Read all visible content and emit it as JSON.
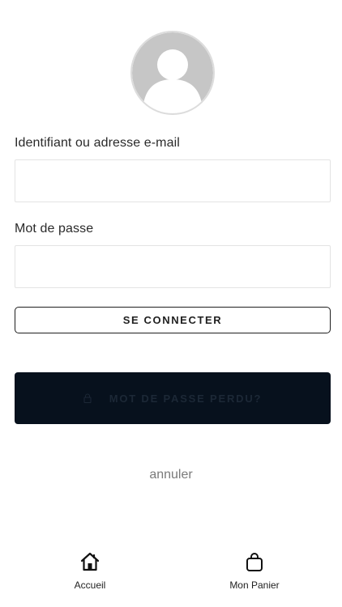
{
  "login_form": {
    "username_label": "Identifiant ou adresse e-mail",
    "username_value": "",
    "password_label": "Mot de passe",
    "password_value": "",
    "login_button_label": "SE CONNECTER",
    "lost_password_label": "MOT DE PASSE PERDU?",
    "cancel_label": "annuler"
  },
  "tab_bar": {
    "items": [
      {
        "label": "Accueil",
        "icon": "home-icon"
      },
      {
        "label": "Mon Panier",
        "icon": "shopping-bag-icon"
      }
    ]
  },
  "colors": {
    "background": "#ffffff",
    "text": "#1f1f1f",
    "dark_button": "#07111d",
    "muted_text": "#7a7a7a",
    "avatar_gray": "#c6c6c6"
  }
}
